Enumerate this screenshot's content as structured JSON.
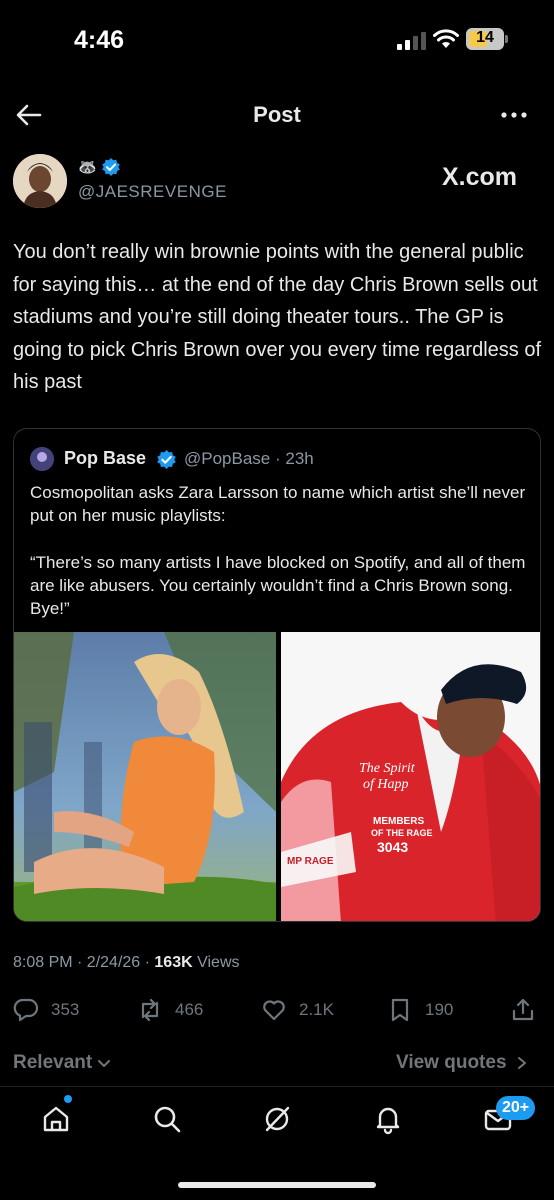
{
  "status_bar": {
    "time": "4:46",
    "battery": "14"
  },
  "header": {
    "title": "Post"
  },
  "author": {
    "emoji": "🦝",
    "handle": "@JAESREVENGE",
    "watermark": "X.com"
  },
  "post": {
    "text": "You don’t really win brownie points with the general public for saying this… at the end of the day Chris Brown sells out stadiums and you’re still doing theater tours.. The GP is going to pick Chris Brown over you every time regardless of his past"
  },
  "quote": {
    "name": "Pop Base",
    "handle_time": "@PopBase · 23h",
    "paragraph1": "Cosmopolitan asks Zara Larsson to name which artist she’ll never put on her music playlists:",
    "paragraph2": "“There’s so many artists I have blocked on Spotify, and all of them are like abusers. You certainly wouldn’t find a Chris Brown song. Bye!”",
    "jacket_text": "The Spirit of Happ MEMBERS OF THE RAGE 3043"
  },
  "meta": {
    "time_date": "8:08 PM · 2/24/26 · ",
    "views_count": "163K",
    "views_label": " Views"
  },
  "actions": {
    "replies": "353",
    "reposts": "466",
    "likes": "2.1K",
    "bookmarks": "190"
  },
  "replies_bar": {
    "sort_label": "Relevant",
    "view_quotes_label": "View quotes"
  },
  "bottom_nav": {
    "messages_badge": "20+"
  },
  "colors": {
    "accent": "#1d9bf0",
    "background": "#000000",
    "muted": "#71767b"
  }
}
